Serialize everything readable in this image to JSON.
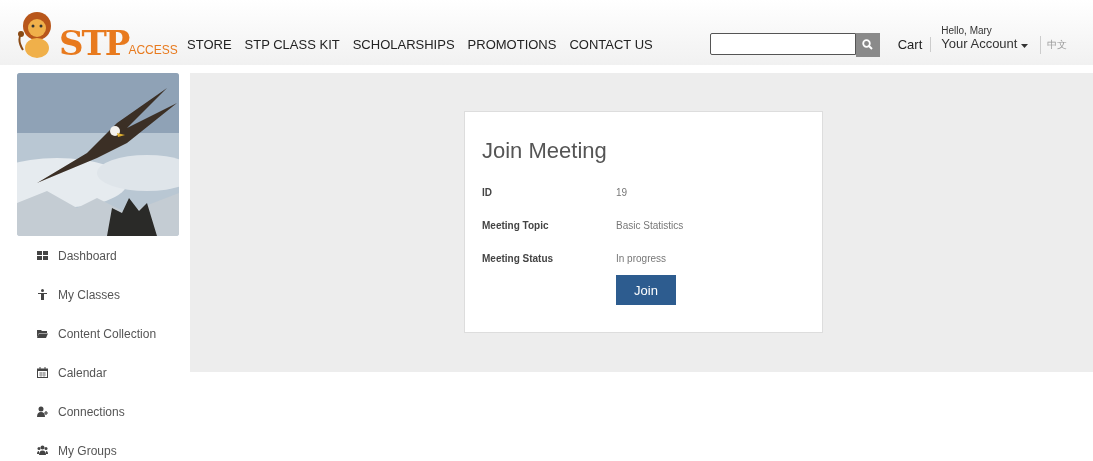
{
  "logo": {
    "main": "STP",
    "sub": "ACCESS"
  },
  "nav": [
    {
      "label": "STORE"
    },
    {
      "label": "STP CLASS KIT"
    },
    {
      "label": "SCHOLARSHIPS"
    },
    {
      "label": "PROMOTIONS"
    },
    {
      "label": "CONTACT US"
    }
  ],
  "cart": "Cart",
  "account": {
    "greeting": "Hello, Mary",
    "label": "Your Account"
  },
  "language": "中文",
  "sidebar": {
    "items": [
      {
        "label": "Dashboard",
        "kind": "dashboard"
      },
      {
        "label": "My Classes",
        "kind": "classes"
      },
      {
        "label": "Content Collection",
        "kind": "folder"
      },
      {
        "label": "Calendar",
        "kind": "calendar"
      },
      {
        "label": "Connections",
        "kind": "connections"
      },
      {
        "label": "My Groups",
        "kind": "groups"
      }
    ]
  },
  "card": {
    "title": "Join Meeting",
    "fields": [
      {
        "label": "ID",
        "value": "19"
      },
      {
        "label": "Meeting Topic",
        "value": "Basic Statistics"
      },
      {
        "label": "Meeting Status",
        "value": "In progress"
      }
    ],
    "button": "Join"
  }
}
